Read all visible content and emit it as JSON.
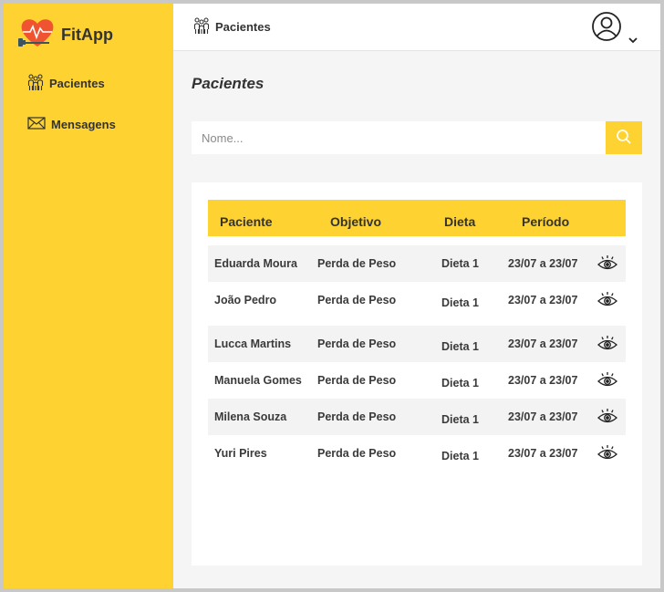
{
  "app": {
    "name": "FitApp",
    "colors": {
      "accent": "#fdd231",
      "text": "#333333",
      "logo_heart": "#f0532f"
    }
  },
  "sidebar": {
    "items": [
      {
        "label": "Pacientes",
        "icon": "people-icon"
      },
      {
        "label": "Mensagens",
        "icon": "envelope-icon"
      }
    ]
  },
  "header": {
    "breadcrumb": "Pacientes",
    "user_icon": "user-circle-icon",
    "menu_icon": "chevron-down-icon"
  },
  "main": {
    "title": "Pacientes",
    "search": {
      "placeholder": "Nome...",
      "value": "",
      "button_icon": "search-icon"
    },
    "table": {
      "columns": [
        "Paciente",
        "Objetivo",
        "Dieta",
        "Período"
      ],
      "rows": [
        {
          "paciente": "Eduarda Moura",
          "objetivo": "Perda de Peso",
          "dieta": "Dieta 1",
          "periodo": "23/07 a 23/07"
        },
        {
          "paciente": "João Pedro",
          "objetivo": "Perda de Peso",
          "dieta": "Dieta 1",
          "periodo": "23/07 a 23/07"
        },
        {
          "paciente": "Lucca Martins",
          "objetivo": "Perda de Peso",
          "dieta": "Dieta 1",
          "periodo": "23/07 a 23/07"
        },
        {
          "paciente": "Manuela Gomes",
          "objetivo": "Perda de Peso",
          "dieta": "Dieta 1",
          "periodo": "23/07 a 23/07"
        },
        {
          "paciente": "Milena Souza",
          "objetivo": "Perda de Peso",
          "dieta": "Dieta 1",
          "periodo": "23/07 a 23/07"
        },
        {
          "paciente": "Yuri Pires",
          "objetivo": "Perda de Peso",
          "dieta": "Dieta 1",
          "periodo": "23/07 a 23/07"
        }
      ],
      "row_action_icon": "eye-icon"
    }
  }
}
